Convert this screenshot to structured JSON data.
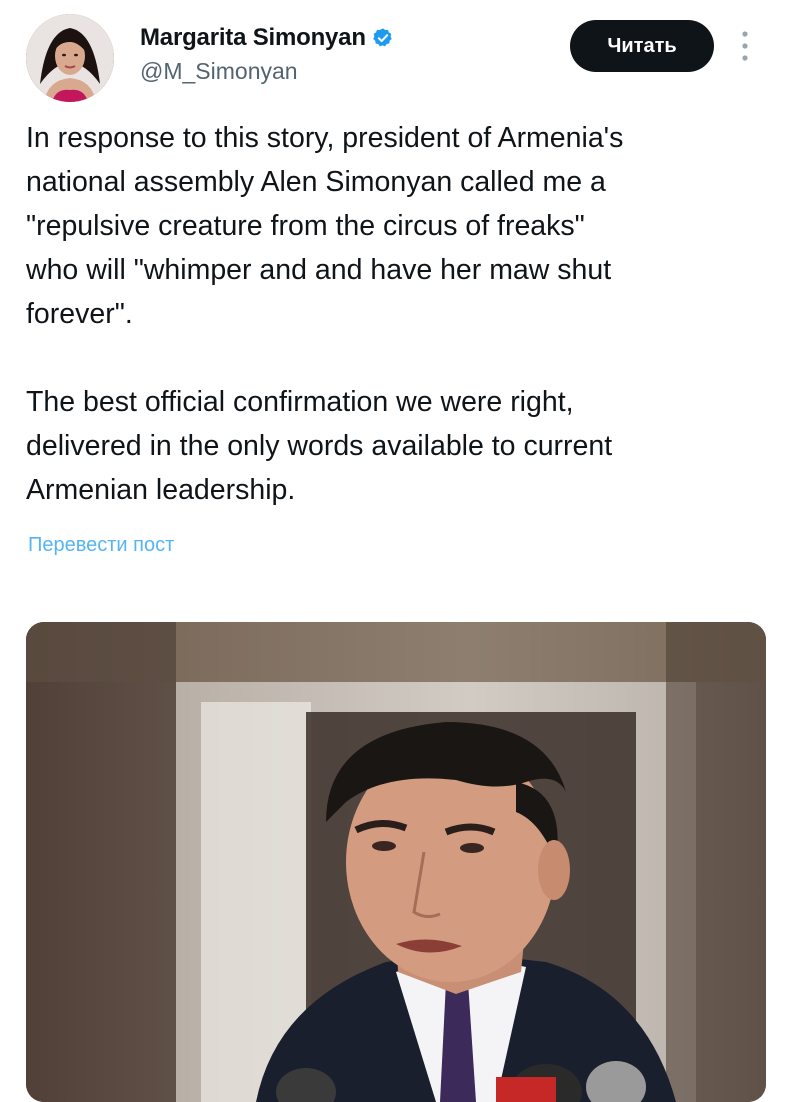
{
  "author": {
    "name": "Margarita Simonyan",
    "handle": "@M_Simonyan",
    "verified_icon": "verified-badge-icon"
  },
  "actions": {
    "follow_label": "Читать",
    "more_icon": "more-vertical-icon"
  },
  "tweet": {
    "paragraphs": [
      "In response to this story, president of Armenia's\nnational assembly Alen Simonyan called me a\n\"repulsive creature from the circus of freaks\"\nwho will \"whimper and and have her maw shut\nforever\".",
      "The best official confirmation we were right,\ndelivered in the only words available to current\nArmenian leadership."
    ],
    "translate_label": "Перевести пост"
  },
  "colors": {
    "text": "#0f1419",
    "secondary": "#536471",
    "accent": "#1d9bf0",
    "button_bg": "#0f1419"
  }
}
